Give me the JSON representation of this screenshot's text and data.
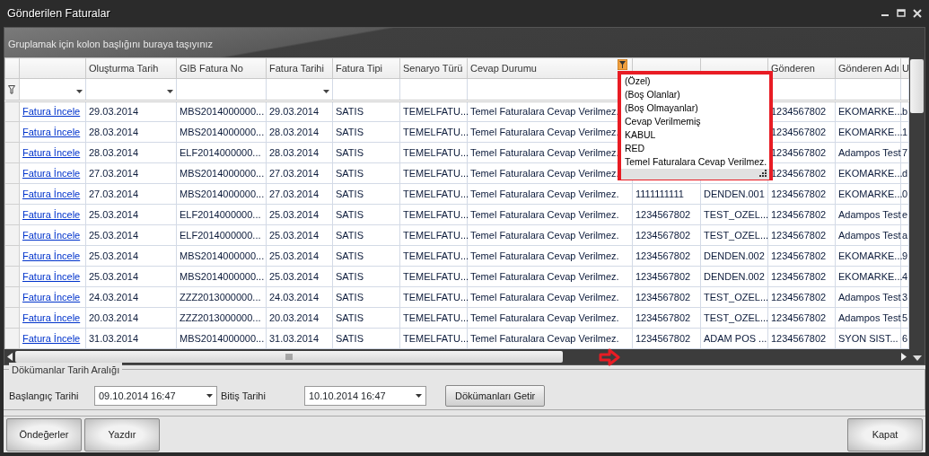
{
  "window": {
    "title": "Gönderilen Faturalar"
  },
  "group_panel": {
    "hint": "Gruplamak için kolon başlığını buraya taşıyınız"
  },
  "grid": {
    "columns": [
      {
        "filter_dropdown": true,
        "filter_active": false
      },
      {
        "label": "Oluşturma Tarih",
        "filter_dropdown": true,
        "filter_active": false
      },
      {
        "label": "GIB Fatura No",
        "filter_dropdown": false,
        "filter_active": false
      },
      {
        "label": "Fatura Tarihi",
        "filter_dropdown": true,
        "filter_active": false
      },
      {
        "label": "Fatura Tipi",
        "filter_dropdown": false,
        "filter_active": false
      },
      {
        "label": "Senaryo Türü",
        "filter_dropdown": false,
        "filter_active": false
      },
      {
        "label": "Cevap Durumu",
        "filter_dropdown": false,
        "filter_active": true
      },
      {},
      {},
      {
        "label": "Gönderen",
        "filter_dropdown": false,
        "filter_active": false
      },
      {
        "label": "Gönderen Adı",
        "filter_dropdown": false,
        "filter_active": false
      },
      {
        "label": "U",
        "filter_dropdown": false,
        "filter_active": false
      }
    ],
    "rows": [
      {
        "cells": [
          "Fatura İncele",
          "29.03.2014",
          "MBS2014000000...",
          "29.03.2014",
          "SATIS",
          "TEMELFATU...",
          "Temel Faturalara Cevap Verilmez.",
          null,
          null,
          "1234567802",
          "EKOMARKE...",
          "b"
        ]
      },
      {
        "cells": [
          "Fatura İncele",
          "28.03.2014",
          "MBS2014000000...",
          "28.03.2014",
          "SATIS",
          "TEMELFATU...",
          "Temel Faturalara Cevap Verilmez.",
          null,
          null,
          "1234567802",
          "EKOMARKE...",
          "1"
        ]
      },
      {
        "cells": [
          "Fatura İncele",
          "28.03.2014",
          "ELF2014000000...",
          "28.03.2014",
          "SATIS",
          "TEMELFATU...",
          "Temel Faturalara Cevap Verilmez.",
          null,
          null,
          "1234567802",
          "Adampos Test",
          "7"
        ]
      },
      {
        "cells": [
          "Fatura İncele",
          "27.03.2014",
          "MBS2014000000...",
          "27.03.2014",
          "SATIS",
          "TEMELFATU...",
          "Temel Faturalara Cevap Verilmez.",
          null,
          null,
          "1234567802",
          "EKOMARKE...",
          "d"
        ]
      },
      {
        "cells": [
          "Fatura İncele",
          "27.03.2014",
          "MBS2014000000...",
          "27.03.2014",
          "SATIS",
          "TEMELFATU...",
          "Temel Faturalara Cevap Verilmez.",
          "1111111111",
          "DENDEN.001",
          "1234567802",
          "EKOMARKE...",
          "0"
        ]
      },
      {
        "cells": [
          "Fatura İncele",
          "25.03.2014",
          "ELF2014000000...",
          "25.03.2014",
          "SATIS",
          "TEMELFATU...",
          "Temel Faturalara Cevap Verilmez.",
          "1234567802",
          "TEST_OZEL...",
          "1234567802",
          "Adampos Test",
          "e"
        ]
      },
      {
        "cells": [
          "Fatura İncele",
          "25.03.2014",
          "ELF2014000000...",
          "25.03.2014",
          "SATIS",
          "TEMELFATU...",
          "Temel Faturalara Cevap Verilmez.",
          "1234567802",
          "TEST_OZEL...",
          "1234567802",
          "Adampos Test",
          "a"
        ]
      },
      {
        "cells": [
          "Fatura İncele",
          "25.03.2014",
          "MBS2014000000...",
          "25.03.2014",
          "SATIS",
          "TEMELFATU...",
          "Temel Faturalara Cevap Verilmez.",
          "1234567802",
          "DENDEN.002",
          "1234567802",
          "EKOMARKE...",
          "9"
        ]
      },
      {
        "cells": [
          "Fatura İncele",
          "25.03.2014",
          "MBS2014000000...",
          "25.03.2014",
          "SATIS",
          "TEMELFATU...",
          "Temel Faturalara Cevap Verilmez.",
          "1234567802",
          "DENDEN.002",
          "1234567802",
          "EKOMARKE...",
          "4"
        ]
      },
      {
        "cells": [
          "Fatura İncele",
          "24.03.2014",
          "ZZZ2013000000...",
          "24.03.2014",
          "SATIS",
          "TEMELFATU...",
          "Temel Faturalara Cevap Verilmez.",
          "1234567802",
          "TEST_OZEL...",
          "1234567802",
          "Adampos Test",
          "3"
        ]
      },
      {
        "cells": [
          "Fatura İncele",
          "20.03.2014",
          "ZZZ2013000000...",
          "20.03.2014",
          "SATIS",
          "TEMELFATU...",
          "Temel Faturalara Cevap Verilmez.",
          "1234567802",
          "TEST_OZEL...",
          "1234567802",
          "Adampos Test",
          "5"
        ]
      },
      {
        "cells": [
          "Fatura İncele",
          "31.03.2014",
          "MBS2014000000...",
          "31.03.2014",
          "SATIS",
          "TEMELFATU...",
          "Temel Faturalara Cevap Verilmez.",
          "1234567802",
          "ADAM POS ...",
          "1234567802",
          "SYON SIST...",
          "6"
        ]
      }
    ]
  },
  "filter_popup": {
    "items": [
      "(Özel)",
      "(Boş Olanlar)",
      "(Boş Olmayanlar)",
      "Cevap Verilmemiş",
      "KABUL",
      "RED",
      "Temel Faturalara Cevap Verilmez."
    ]
  },
  "date_range": {
    "title": "Dökümanlar Tarih Aralığı",
    "start_label": "Başlangıç Tarihi",
    "start_value": "09.10.2014 16:47",
    "end_label": "Bitiş Tarihi",
    "end_value": "10.10.2014 16:47",
    "button": "Dökümanları Getir"
  },
  "footer": {
    "left_buttons": [
      "Öndeğerler",
      "Yazdır"
    ],
    "right_buttons": [
      "Kapat"
    ]
  }
}
